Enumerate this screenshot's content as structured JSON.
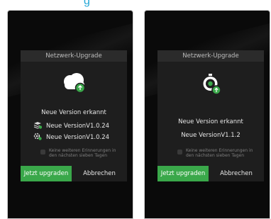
{
  "header": {
    "partial_text": "g"
  },
  "left_phone": {
    "dialog_title": "Netzwerk-Upgrade",
    "message": "Neue Version erkannt",
    "items": [
      {
        "icon": "layers-check-icon",
        "label": "Neue VersionV1.0.24"
      },
      {
        "icon": "gear-refresh-icon",
        "label": "Neue VersionV1.0.24"
      }
    ],
    "reminder": "Keine weiteren Erinnerungen in den nächsten sieben Tagen",
    "primary_button": "Jetzt upgraden",
    "secondary_button": "Abbrechen"
  },
  "right_phone": {
    "dialog_title": "Netzwerk-Upgrade",
    "message": "Neue Version erkannt",
    "version": "Neue VersionV1.1.2",
    "reminder": "Keine weiteren Erinnerungen in den nächsten sieben Tagen",
    "primary_button": "Jetzt upgraden",
    "secondary_button": "Abbrechen"
  },
  "colors": {
    "accent": "#3aa84a",
    "link": "#22a6d6",
    "dialog": "#1e1e1e"
  }
}
